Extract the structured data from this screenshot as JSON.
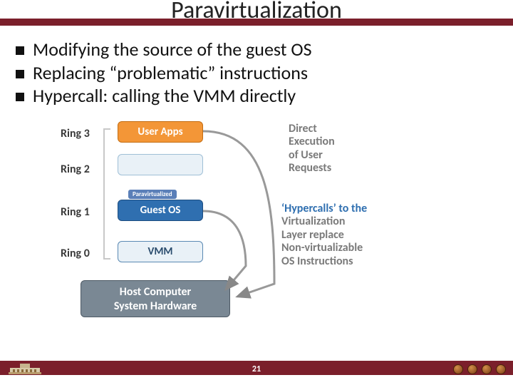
{
  "title": "Paravirtualization",
  "bullets": [
    "Modifying the source of the guest OS",
    "Replacing “problematic” instructions",
    "Hypercall: calling the VMM directly"
  ],
  "rings": {
    "r3": "Ring 3",
    "r2": "Ring 2",
    "r1": "Ring 1",
    "r0": "Ring 0"
  },
  "boxes": {
    "user": "User Apps",
    "pv_label": "Paravirtualized",
    "guest": "Guest OS",
    "vmm": "VMM",
    "hw_l1": "Host Computer",
    "hw_l2": "System Hardware"
  },
  "notes": {
    "direct_l1": "Direct",
    "direct_l2": "Execution",
    "direct_l3": "of User",
    "direct_l4": "Requests",
    "hc_l1": "‘Hypercalls’ to the",
    "hc_l2": "Virtualization",
    "hc_l3": "Layer replace",
    "hc_l4": "Non-virtualizable",
    "hc_l5": "OS Instructions"
  },
  "page": "21"
}
